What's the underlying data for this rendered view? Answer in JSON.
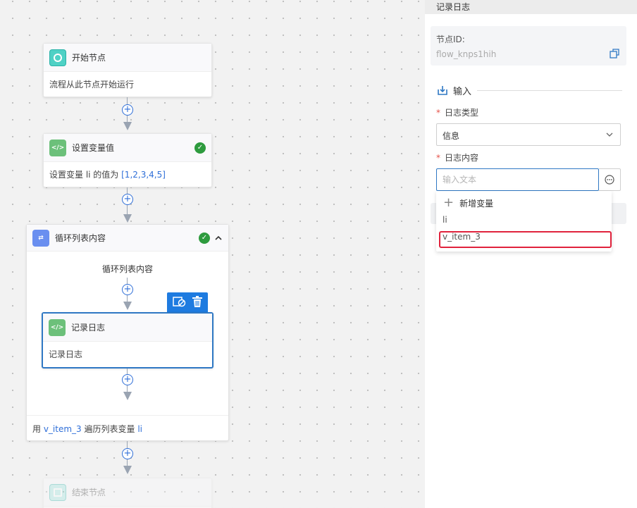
{
  "canvas": {
    "start_node": {
      "title": "开始节点",
      "body": "流程从此节点开始运行"
    },
    "set_var_node": {
      "title": "设置变量值",
      "body_prefix": "设置变量 li 的值为 ",
      "body_value": "[1,2,3,4,5]",
      "icon": "</>"
    },
    "loop_node": {
      "title": "循环列表内容",
      "inner_label": "循环列表内容",
      "footer_prefix": "用 ",
      "footer_var": "v_item_3",
      "footer_middle": " 遍历列表变量 ",
      "footer_list": "li"
    },
    "log_node": {
      "title": "记录日志",
      "body": "记录日志",
      "icon": "</>"
    },
    "end_node": {
      "title": "结束节点"
    },
    "plus": "+"
  },
  "panel": {
    "title": "记录日志",
    "node_id_label": "节点ID:",
    "node_id_value": "flow_knps1hih",
    "section_input": "输入",
    "log_type_label": "日志类型",
    "log_type_value": "信息",
    "log_content_label": "日志内容",
    "log_content_placeholder": "输入文本",
    "dropdown": {
      "add_label": "新增变量",
      "items": [
        "li",
        "v_item_3"
      ]
    }
  },
  "colors": {
    "accent": "#2f78c4",
    "highlight": "#e0223c",
    "check_green": "#2e9b3e"
  }
}
